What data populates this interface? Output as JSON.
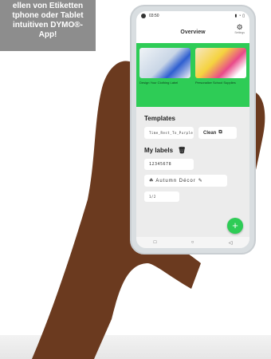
{
  "promo": {
    "line1": "ellen von Etiketten",
    "line2": "tphone oder Tablet",
    "line3": "intuitiven DYMO®-",
    "line4": "App!"
  },
  "status": {
    "time": "03:50"
  },
  "appbar": {
    "title": "Overview",
    "settings_label": "Settings",
    "gear_icon": "gear-icon"
  },
  "banner": {
    "color": "#2ecc56",
    "cards": [
      {
        "caption": "Design Your Clothing Label"
      },
      {
        "caption": "Personalize School Supplies"
      }
    ]
  },
  "templates": {
    "heading": "Templates",
    "items": [
      {
        "text": "Time_Rest_To_Purple"
      },
      {
        "text": "Clean"
      }
    ]
  },
  "labels": {
    "heading": "My labels",
    "trash_icon": "trash-icon",
    "items": [
      {
        "text": "12345678"
      },
      {
        "text": "Autumn Décor"
      },
      {
        "text": "1/2"
      }
    ]
  },
  "fab": {
    "label": "+"
  },
  "nav": {
    "square": "□",
    "circle": "○",
    "back": "◁"
  }
}
